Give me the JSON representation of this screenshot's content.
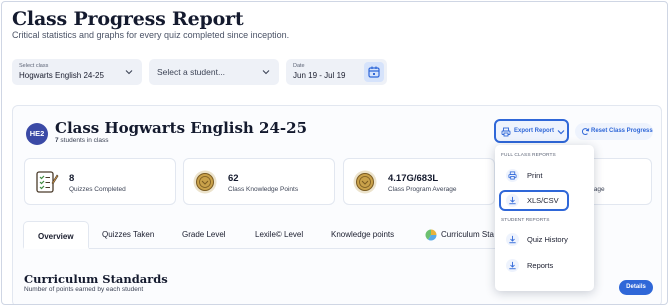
{
  "header": {
    "title": "Class Progress Report",
    "subtitle": "Critical statistics and graphs for every quiz completed since inception."
  },
  "filters": {
    "class_label": "Select class",
    "class_value": "Hogwarts English 24-25",
    "student_placeholder": "Select a student...",
    "date_label": "Date",
    "date_value": "Jun 19 - Jul 19"
  },
  "class_card": {
    "initials": "HE2",
    "name": "Class Hogwarts English 24-25",
    "student_count": "7",
    "student_suffix": " students in class",
    "export_label": "Export Report",
    "reset_label": "Reset Class Progress"
  },
  "stats": [
    {
      "value": "8",
      "caption": "Quizzes Completed",
      "icon": "quiz-checklist-icon"
    },
    {
      "value": "62",
      "caption": "Class Knowledge Points",
      "icon": "medal-icon"
    },
    {
      "value": "4.17G/683L",
      "caption": "Class Program Average",
      "icon": "medal-icon"
    },
    {
      "value": "",
      "caption": "erage",
      "icon": ""
    }
  ],
  "tabs": [
    "Overview",
    "Quizzes Taken",
    "Grade Level",
    "Lexile© Level",
    "Knowledge points",
    "Curriculum Sta"
  ],
  "active_tab": "Overview",
  "section": {
    "title": "Curriculum Standards",
    "subtitle": "Number of points earned by each student",
    "details_label": "Details"
  },
  "export_menu": {
    "full_reports_heading": "FULL CLASS REPORTS",
    "student_reports_heading": "STUDENT REPORTS",
    "items": [
      "Print",
      "XLS/CSV",
      "Quiz History",
      "Reports"
    ],
    "highlighted": "XLS/CSV"
  },
  "colors": {
    "accent": "#2f67d8",
    "accent_light": "#eef3fd",
    "avatar": "#3b4aa6",
    "field_bg": "#eef1f7",
    "medal": "#c9a14a"
  }
}
